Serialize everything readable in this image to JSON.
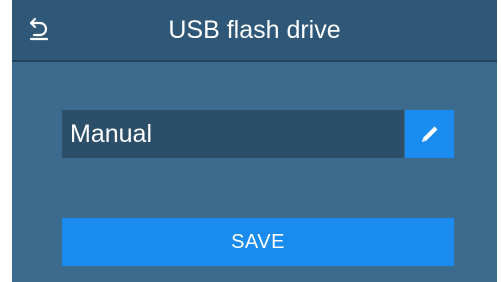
{
  "header": {
    "title": "USB flash drive",
    "back_icon": "back-arrow-icon"
  },
  "form": {
    "field_value": "Manual",
    "edit_icon": "pencil-icon"
  },
  "actions": {
    "save_label": "SAVE"
  },
  "colors": {
    "background": "#3d6b8e",
    "header": "#2f5878",
    "field": "#2c4f69",
    "accent": "#1a8cf0",
    "text": "#ffffff"
  }
}
